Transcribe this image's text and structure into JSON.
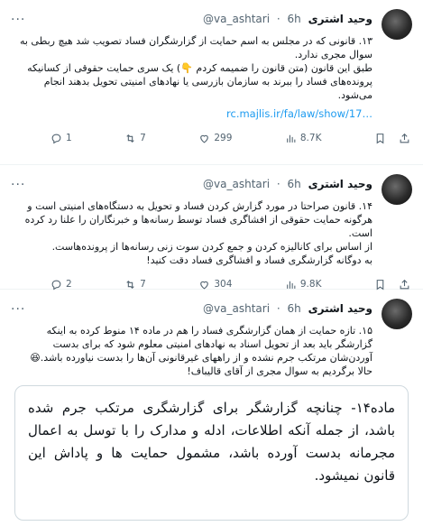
{
  "tweets": [
    {
      "author": "وحید اشتری",
      "handle": "@va_ashtari",
      "dot": "·",
      "time": "6h",
      "paragraphs": [
        "۱۳. قانونی که در مجلس به اسم حمایت از گزارشگران فساد تصویب شد هیچ ربطی به سوال مجری ندارد.",
        "طبق این قانون (متن قانون را ضمیمه کردم 👇) یک سری حمایت حقوقی از کسانیکه پرونده‌های فساد را ببرند به سازمان بازرسی یا نهادهای امنیتی تحویل بدهند انجام می‌شود."
      ],
      "link": "rc.majlis.ir/fa/law/show/17…",
      "actions": {
        "reply": "1",
        "retweet": "7",
        "like": "299",
        "views": "8.7K"
      }
    },
    {
      "author": "وحید اشتری",
      "handle": "@va_ashtari",
      "dot": "·",
      "time": "6h",
      "paragraphs": [
        "۱۴. قانون صراحتا در مورد گزارش کردن فساد و تحویل به دستگاه‌های امنیتی است و هرگونه حمایت حقوقی از افشاگری فساد توسط رسانه‌ها و خبرنگاران را علنا رد کرده است.",
        "از اساس برای کانالیزه کردن و جمع کردن سوت زنی رسانه‌ها از پرونده‌هاست.",
        "به دوگانه گزارشگری فساد و افشاگری فساد دقت کنید!"
      ],
      "actions": {
        "reply": "2",
        "retweet": "7",
        "like": "304",
        "views": "9.8K"
      }
    },
    {
      "author": "وحید اشتری",
      "handle": "@va_ashtari",
      "dot": "·",
      "time": "6h",
      "paragraphs": [
        "۱۵. تازه حمایت از همان گزارشگری فساد را هم در ماده ۱۴ منوط کرده به اینکه گزارشگر باید بعد از تحویل اسناد به نهادهای امنیتی معلوم شود که برای بدست آوردن‌شان مرتکب جرم نشده و از راههای غیرقانونی آن‌ها را بدست نیاورده باشد.😆",
        "حالا برگردیم به سوال مجری از آقای قالیباف!"
      ],
      "quote": "ماده۱۴- چنانچه گزارشگر برای گزارشگری مرتکب جرم شده باشد، از جمله آنکه اطلاعات، ادله و مدارک را با توسل به اعمال مجرمانه بدست آورده باشد، مشمول حمایت ها و پاداش این قانون نمیشود."
    }
  ]
}
